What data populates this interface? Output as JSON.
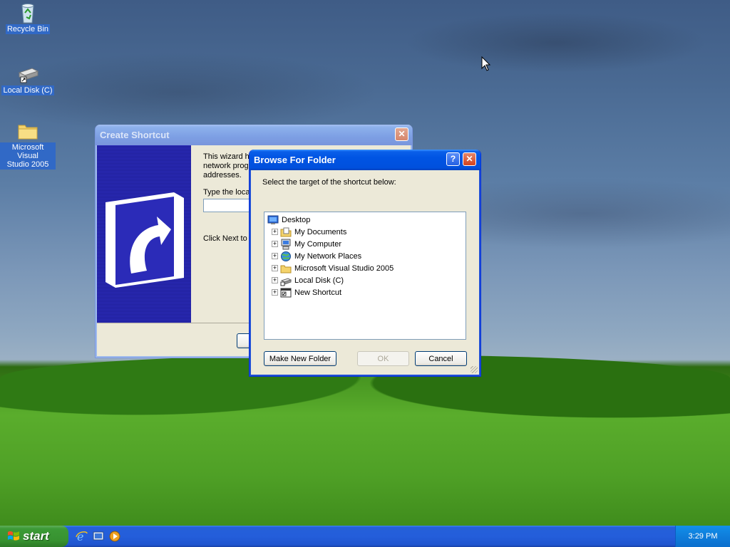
{
  "desktop": {
    "icons": [
      {
        "label": "Recycle Bin"
      },
      {
        "label": "Local Disk (C)"
      },
      {
        "label_line1": "Microsoft Visual",
        "label_line2": "Studio 2005"
      }
    ]
  },
  "create_shortcut": {
    "title": "Create Shortcut",
    "body_line1": "This wizard he",
    "body_line2": "network prog",
    "body_line3": "addresses.",
    "type_label": "Type the loca",
    "location_value": "",
    "next_hint": "Click Next to c"
  },
  "browse_folder": {
    "title": "Browse For Folder",
    "instruction": "Select the target of the shortcut below:",
    "tree": {
      "root": "Desktop",
      "items": [
        "My Documents",
        "My Computer",
        "My Network Places",
        "Microsoft Visual Studio 2005",
        "Local Disk (C)",
        "New Shortcut"
      ]
    },
    "buttons": {
      "make_new_folder": "Make New Folder",
      "ok": "OK",
      "cancel": "Cancel"
    },
    "help_glyph": "?",
    "close_glyph": "✕"
  },
  "taskbar": {
    "start_label": "start",
    "clock": "3:29 PM"
  },
  "colors": {
    "accent_title": "#0054e3",
    "taskbar": "#245edb",
    "start_green": "#379230"
  }
}
